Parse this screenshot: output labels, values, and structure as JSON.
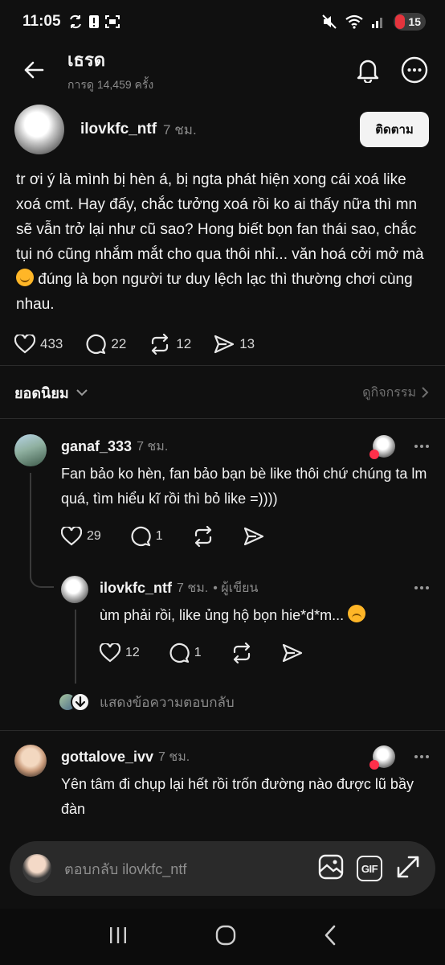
{
  "status_bar": {
    "time": "11:05",
    "battery": "15"
  },
  "header": {
    "title": "เธรด",
    "subtitle": "การดู 14,459 ครั้ง"
  },
  "post": {
    "username": "ilovkfc_ntf",
    "time": "7 ชม.",
    "follow_label": "ติดตาม",
    "text_before_emoji": "tr ơi ý là mình bị hèn á, bị ngta phát hiện xong cái xoá like xoá cmt. Hay đấy, chắc tưởng xoá rồi ko ai thấy nữa thì mn sẽ vẫn trở lại như cũ sao? Hong biết bọn fan thái sao, chắc tụi nó cũng nhắm mắt cho qua thôi nhỉ... văn hoá cởi mở mà ",
    "text_after_emoji": " đúng là bọn người tư duy lệch lạc thì thường chơi cùng nhau.",
    "likes": "433",
    "comments": "22",
    "reposts": "12",
    "shares": "13"
  },
  "sort": {
    "label": "ยอดนิยม",
    "activity_link": "ดูกิจกรรม"
  },
  "comments": [
    {
      "username": "ganaf_333",
      "time": "7 ชม.",
      "text": "Fan bảo ko hèn, fan bảo bạn bè like thôi chứ chúng ta lm quá, tìm hiểu kĩ rồi thì bỏ like =))))",
      "likes": "29",
      "replies": "1"
    },
    {
      "username": "ilovkfc_ntf",
      "time": "7 ชม.",
      "author_tag": "• ผู้เขียน",
      "text": "ùm phải rồi, like ủng hộ bọn hie*d*m... ",
      "likes": "12",
      "replies": "1"
    },
    {
      "username": "gottalove_ivv",
      "time": "7 ชม.",
      "text": "Yên tâm đi chụp lại hết rồi trốn đường nào được lũ bầy đàn"
    }
  ],
  "show_replies_label": "แสดงข้อความตอบกลับ",
  "reply_bar": {
    "placeholder": "ตอบกลับ ilovkfc_ntf",
    "gif_label": "GIF"
  }
}
